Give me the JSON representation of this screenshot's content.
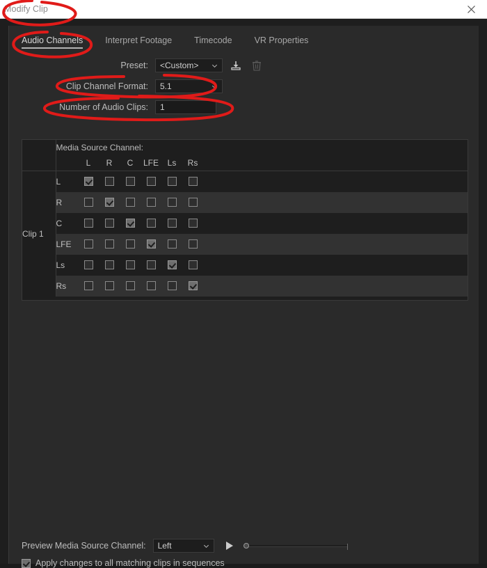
{
  "window": {
    "title": "Modify Clip",
    "close_icon": "close-icon"
  },
  "tabs": [
    {
      "label": "Audio Channels",
      "active": true
    },
    {
      "label": "Interpret Footage",
      "active": false
    },
    {
      "label": "Timecode",
      "active": false
    },
    {
      "label": "VR Properties",
      "active": false
    }
  ],
  "form": {
    "preset": {
      "label": "Preset:",
      "value": "<Custom>",
      "save_icon": "save-preset-icon",
      "delete_icon": "trash-icon"
    },
    "clip_channel_format": {
      "label": "Clip Channel Format:",
      "value": "5.1"
    },
    "number_of_audio_clips": {
      "label": "Number of Audio Clips:",
      "value": "1"
    }
  },
  "matrix": {
    "header_title": "Media Source Channel:",
    "source_columns": [
      "L",
      "R",
      "C",
      "LFE",
      "Ls",
      "Rs"
    ],
    "clip_label": "Clip 1",
    "rows": [
      {
        "channel": "L",
        "checks": [
          true,
          false,
          false,
          false,
          false,
          false
        ]
      },
      {
        "channel": "R",
        "checks": [
          false,
          true,
          false,
          false,
          false,
          false
        ]
      },
      {
        "channel": "C",
        "checks": [
          false,
          false,
          true,
          false,
          false,
          false
        ]
      },
      {
        "channel": "LFE",
        "checks": [
          false,
          false,
          false,
          true,
          false,
          false
        ]
      },
      {
        "channel": "Ls",
        "checks": [
          false,
          false,
          false,
          false,
          true,
          false
        ]
      },
      {
        "channel": "Rs",
        "checks": [
          false,
          false,
          false,
          false,
          false,
          true
        ]
      }
    ]
  },
  "footer": {
    "preview_label": "Preview Media Source Channel:",
    "preview_value": "Left",
    "play_icon": "play-icon",
    "volume_value": 0,
    "apply_label": "Apply changes to all matching clips in sequences",
    "apply_checked": true
  },
  "annotations": {
    "color": "#e01b19",
    "marks": [
      {
        "name": "circle-title",
        "shape": "ellipse"
      },
      {
        "name": "circle-audio-tab",
        "shape": "ellipse"
      },
      {
        "name": "circle-clip-format",
        "shape": "ellipse"
      },
      {
        "name": "circle-audio-clips",
        "shape": "ellipse"
      }
    ]
  }
}
